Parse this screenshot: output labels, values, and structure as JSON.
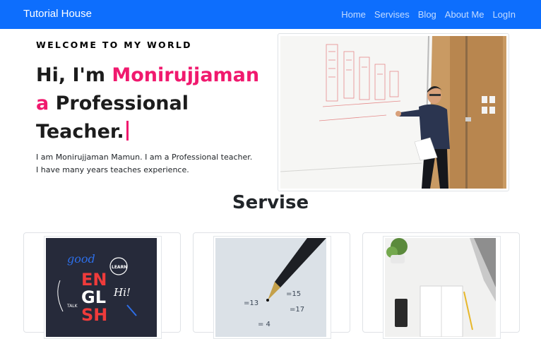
{
  "navbar": {
    "brand": "Tutorial House",
    "links": [
      "Home",
      "Servises",
      "Blog",
      "About Me",
      "LogIn"
    ]
  },
  "hero": {
    "eyebrow": "WELCOME TO MY WORLD",
    "greeting": "Hi, I'm",
    "name": "Monirujjaman",
    "article": "a",
    "role": "Professional Teacher.",
    "bio": "I am Monirujjaman Mamun. I am a Professional teacher. I have many years teaches experience."
  },
  "services": {
    "title": "Servise",
    "cards": [
      {
        "image": "english-poster",
        "lettering": [
          "good",
          "EN",
          "GL",
          "SH",
          "LEARN",
          "Hi!",
          "TALK"
        ]
      },
      {
        "image": "pen-on-math-paper",
        "lettering": [
          "=13",
          "=15",
          "=17",
          "= 4"
        ]
      },
      {
        "image": "desk-with-notebook"
      }
    ]
  },
  "colors": {
    "primary": "#0d6efd",
    "accent": "#f0196e"
  }
}
